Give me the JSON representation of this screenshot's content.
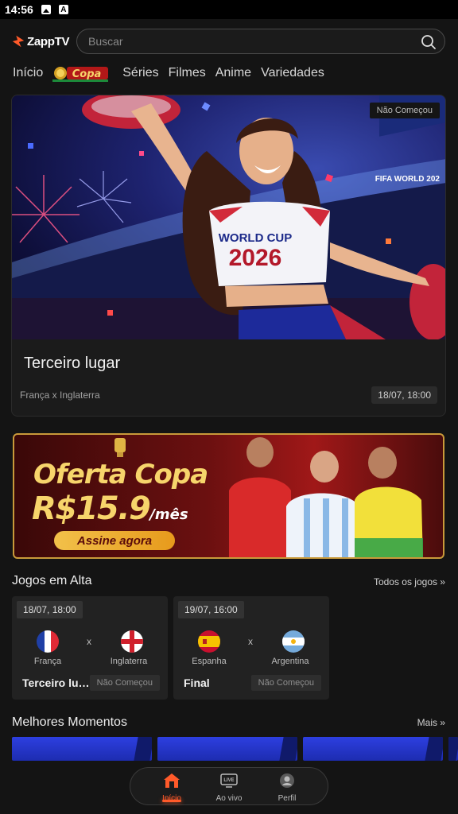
{
  "status_bar": {
    "time": "14:56",
    "icons": [
      "image-icon",
      "font-icon"
    ]
  },
  "header": {
    "logo": "ZappTV",
    "search_placeholder": "Buscar"
  },
  "nav": {
    "items": [
      "Início",
      "Séries",
      "Filmes",
      "Anime",
      "Variedades"
    ],
    "copa_label": "Copa"
  },
  "hero": {
    "badge": "Não Começou",
    "shirt_line1": "WORLD CUP",
    "shirt_line2": "2026",
    "sign_text": "FIFA WORLD 202",
    "title": "Terceiro lugar",
    "teams": "França x Inglaterra",
    "time": "18/07, 18:00"
  },
  "promo": {
    "title": "Oferta Copa",
    "price": "R$15.9",
    "unit": "/mês",
    "cta": "Assine agora"
  },
  "trending": {
    "title": "Jogos em Alta",
    "link": "Todos os jogos »",
    "matches": [
      {
        "time": "18/07, 18:00",
        "home": "França",
        "away": "Inglaterra",
        "vs": "x",
        "name": "Terceiro lugar",
        "status": "Não Começou"
      },
      {
        "time": "19/07, 16:00",
        "home": "Espanha",
        "away": "Argentina",
        "vs": "x",
        "name": "Final",
        "status": "Não Começou"
      }
    ]
  },
  "highlights": {
    "title": "Melhores Momentos",
    "link": "Mais »"
  },
  "bottom_nav": {
    "items": [
      "Início",
      "Ao vivo",
      "Perfil"
    ],
    "live_badge": "LIVE",
    "active": "Início"
  },
  "colors": {
    "accent": "#ff5a2a",
    "background": "#141414",
    "card": "#222222",
    "gold": "#f7d56b"
  }
}
